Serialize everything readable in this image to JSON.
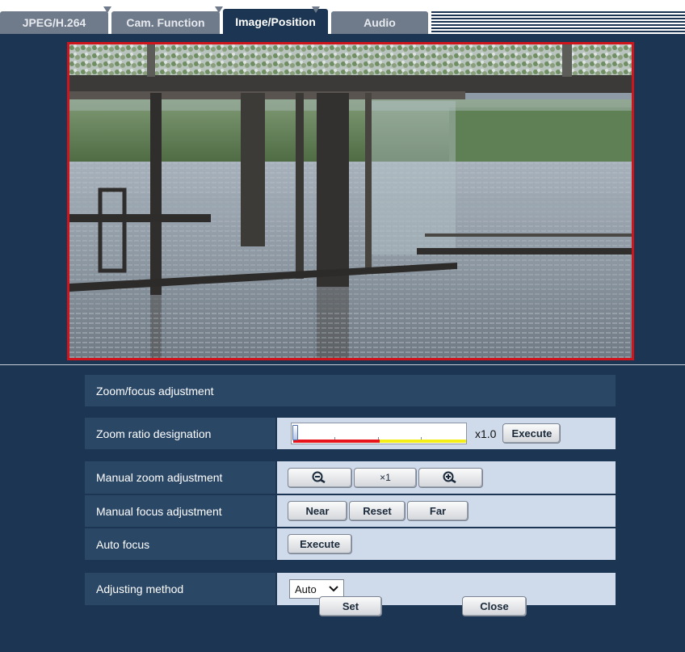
{
  "tabs": [
    {
      "label": "JPEG/H.264",
      "active": false
    },
    {
      "label": "Cam. Function",
      "active": false
    },
    {
      "label": "Image/Position",
      "active": true
    },
    {
      "label": "Audio",
      "active": false
    }
  ],
  "camera": {
    "icon": "live-camera-image",
    "border_color": "#d0141c"
  },
  "section_title": "Zoom/focus adjustment",
  "zoom_ratio": {
    "label": "Zoom ratio designation",
    "value_text": "x1.0",
    "level": 0.0,
    "execute_label": "Execute"
  },
  "manual_zoom": {
    "label": "Manual zoom adjustment",
    "zoom_out_icon": "zoom-out-icon",
    "x1_label": "×1",
    "zoom_in_icon": "zoom-in-icon"
  },
  "manual_focus": {
    "label": "Manual focus adjustment",
    "near_label": "Near",
    "reset_label": "Reset",
    "far_label": "Far"
  },
  "auto_focus": {
    "label": "Auto focus",
    "execute_label": "Execute"
  },
  "adjusting_method": {
    "label": "Adjusting method",
    "selected": "Auto"
  },
  "footer": {
    "set_label": "Set",
    "close_label": "Close"
  },
  "colors": {
    "panel": "#1b3552",
    "row_label": "#2a4766",
    "row_value": "#cfdaeb",
    "accent_red": "#d0141c",
    "zoom_red": "#e8141c",
    "zoom_yellow": "#f3ee17"
  }
}
